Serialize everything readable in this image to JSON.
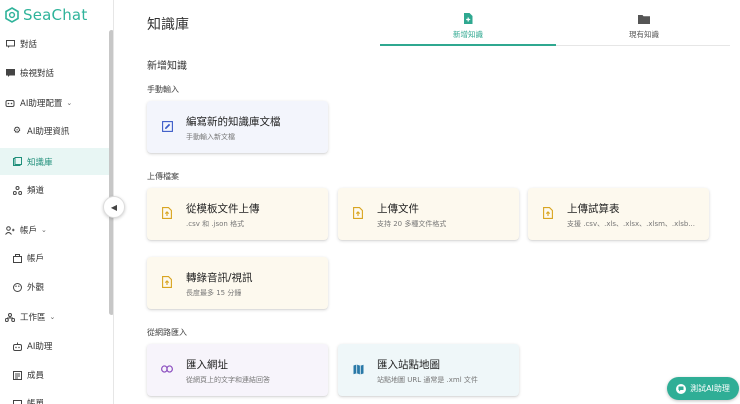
{
  "brand": {
    "name": "SeaChat",
    "color": "#2fb39a"
  },
  "sidebar": {
    "items": [
      {
        "label": "對話",
        "icon": "chat-icon"
      },
      {
        "label": "檢視對話",
        "icon": "review-chat-icon"
      },
      {
        "label": "AI助理配置",
        "icon": "ai-config-icon"
      },
      {
        "label": "AI助理資訊",
        "icon": "gear-icon"
      },
      {
        "label": "知識庫",
        "icon": "knowledge-icon",
        "active": true
      },
      {
        "label": "頻道",
        "icon": "channel-icon"
      },
      {
        "label": "帳戶",
        "icon": "account-icon"
      },
      {
        "label": "帳戶",
        "icon": "account-sub-icon"
      },
      {
        "label": "外觀",
        "icon": "palette-icon"
      },
      {
        "label": "工作區",
        "icon": "workspace-icon"
      },
      {
        "label": "AI助理",
        "icon": "robot-icon"
      },
      {
        "label": "成員",
        "icon": "members-icon"
      },
      {
        "label": "帳單",
        "icon": "billing-icon"
      }
    ],
    "collapse_icon": "chevron-left-icon"
  },
  "main": {
    "title": "知識庫",
    "tabs": [
      {
        "label": "新增知識",
        "icon": "add-file-icon",
        "active": true
      },
      {
        "label": "現有知識",
        "icon": "folder-icon"
      }
    ],
    "section_title": "新增知識",
    "groups": {
      "manual": "手動輸入",
      "upload": "上傳檔案",
      "web": "從網路匯入"
    },
    "cards": {
      "new_doc": {
        "title": "編寫新的知識庫文檔",
        "sub": "手動輸入新文檔",
        "icon": "edit-icon"
      },
      "template": {
        "title": "從模板文件上傳",
        "sub": ".csv 和 .json 格式",
        "icon": "upload-file-icon"
      },
      "upload_doc": {
        "title": "上傳文件",
        "sub": "支持 20 多種文件格式",
        "icon": "upload-file-icon"
      },
      "spreadsheet": {
        "title": "上傳試算表",
        "sub": "支援 .csv、.xls、.xlsx、.xlsm、.xlsb...",
        "icon": "upload-file-icon"
      },
      "transcribe": {
        "title": "轉錄音訊/視訊",
        "sub": "長度最多 15 分鐘",
        "icon": "upload-file-icon"
      },
      "url": {
        "title": "匯入網址",
        "sub": "從網頁上的文字和連結回答",
        "icon": "link-icon"
      },
      "sitemap": {
        "title": "匯入站點地圖",
        "sub": "站點地圖 URL 通常是 .xml 文件",
        "icon": "map-icon"
      }
    },
    "test_button": "測試AI助理"
  }
}
